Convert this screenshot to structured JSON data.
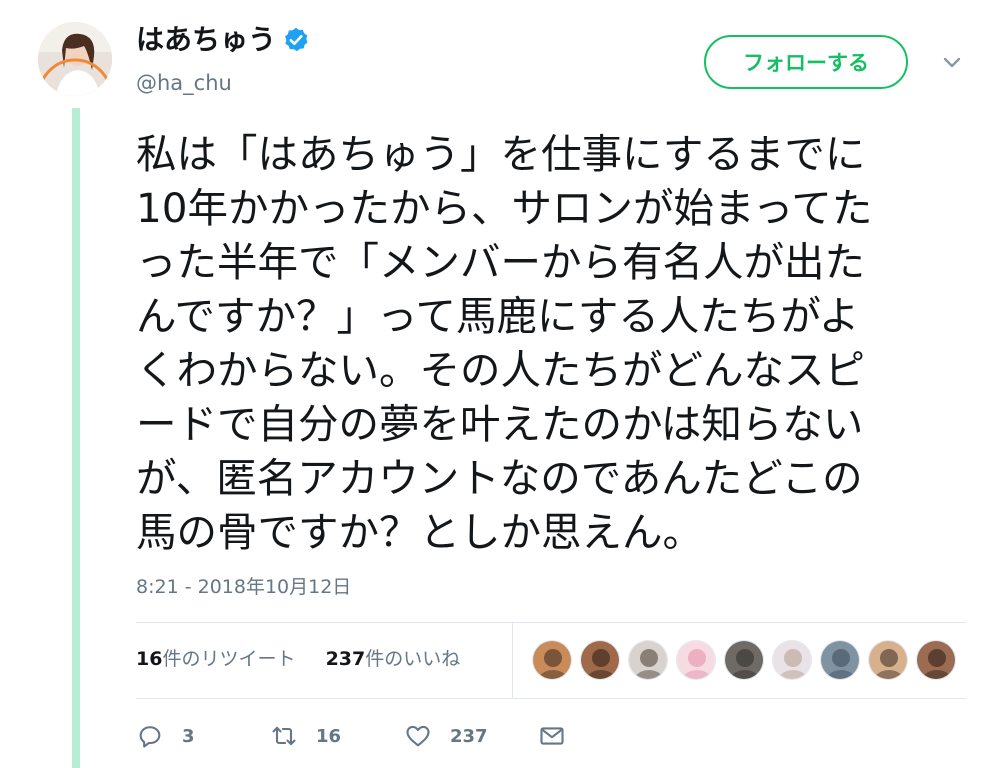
{
  "user": {
    "display_name": "はあちゅう",
    "handle": "@ha_chu",
    "verified": true,
    "avatar_icon": "profile-photo"
  },
  "follow_button": {
    "label": "フォローする"
  },
  "more_menu": {
    "icon": "chevron-down-icon"
  },
  "tweet": {
    "lines": [
      "私は「はあちゅう」を仕事にするまでに",
      "10年かかったから、サロンが始まってた",
      "った半年で「メンバーから有名人が出た",
      "んですか？」って馬鹿にする人たちがよ",
      "くわからない。その人たちがどんなスピ",
      "ードで自分の夢を叶えたのかは知らない",
      "が、匿名アカウントなのであんたどこの",
      "馬の骨ですか？としか思えん。"
    ],
    "timestamp": "8:21 - 2018年10月12日"
  },
  "stats": {
    "retweets_count": "16",
    "retweets_label": "件のリツイート",
    "likes_count": "237",
    "likes_label": "件のいいね",
    "likers": [
      {
        "color": "#c98b5a",
        "accent": "#3a2a20"
      },
      {
        "color": "#a06a4a",
        "accent": "#2b1d16"
      },
      {
        "color": "#d8d3cf",
        "accent": "#4a3a30"
      },
      {
        "color": "#f6dbe3",
        "accent": "#e58aa8"
      },
      {
        "color": "#6f6a66",
        "accent": "#2f2b28"
      },
      {
        "color": "#e9e2e6",
        "accent": "#b39a8a"
      },
      {
        "color": "#7f93a3",
        "accent": "#3b4a55"
      },
      {
        "color": "#d7b08e",
        "accent": "#3a2a20"
      },
      {
        "color": "#9b6b52",
        "accent": "#2a1c15"
      }
    ]
  },
  "actions": {
    "reply_count": "3",
    "retweet_count": "16",
    "like_count": "237"
  },
  "colors": {
    "accent_green": "#17bf63",
    "thread_line": "#b8ecd5",
    "verified_blue": "#1da1f2",
    "muted": "#657786"
  }
}
